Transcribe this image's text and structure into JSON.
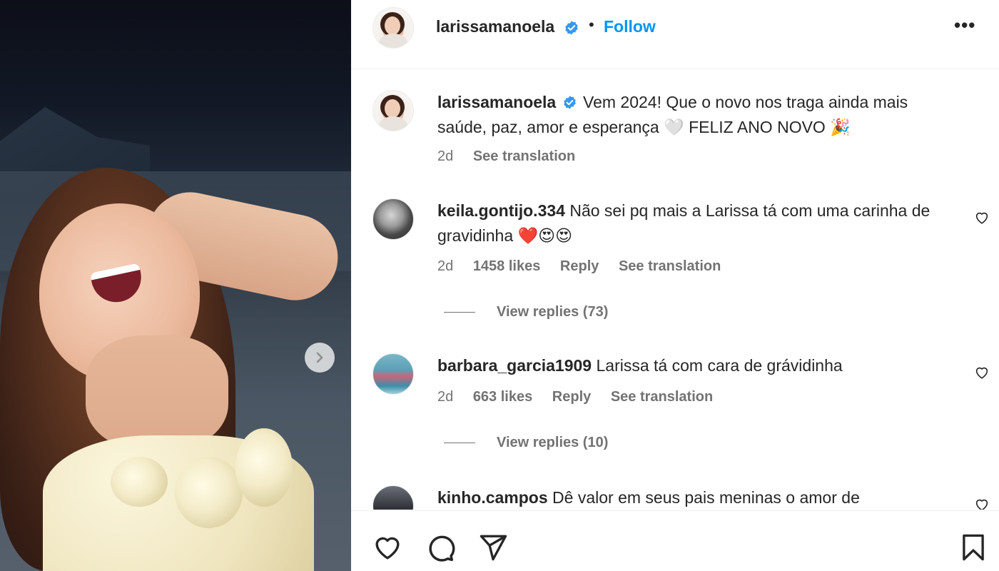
{
  "post": {
    "username": "larissamanoela",
    "follow_label": "Follow",
    "separator": "•",
    "more_label": "•••",
    "caption": "Vem 2024! Que o novo nos traga ainda mais saúde, paz, amor e esperança 🤍 FELIZ ANO NOVO 🎉",
    "caption_age": "2d",
    "see_translation": "See translation"
  },
  "comments": [
    {
      "username": "keila.gontijo.334",
      "text": "Não sei pq mais a Larissa tá com uma carinha de gravidinha ❤️😍😍",
      "age": "2d",
      "likes": "1458 likes",
      "reply": "Reply",
      "see_translation": "See translation",
      "view_replies": "View replies (73)"
    },
    {
      "username": "barbara_garcia1909",
      "text": "Larissa tá com cara de grávidinha",
      "age": "2d",
      "likes": "663 likes",
      "reply": "Reply",
      "see_translation": "See translation",
      "view_replies": "View replies (10)"
    },
    {
      "username": "kinho.campos",
      "text": "Dê valor em seus pais meninas o amor de"
    }
  ],
  "icons": {
    "verified": "verified-badge-icon",
    "next": "chevron-right-icon",
    "like": "heart-icon",
    "comment": "comment-icon",
    "share": "send-icon",
    "save": "bookmark-icon"
  },
  "colors": {
    "accent": "#0095f6",
    "verified": "#3897f0",
    "text": "#262626",
    "muted": "#737373"
  }
}
